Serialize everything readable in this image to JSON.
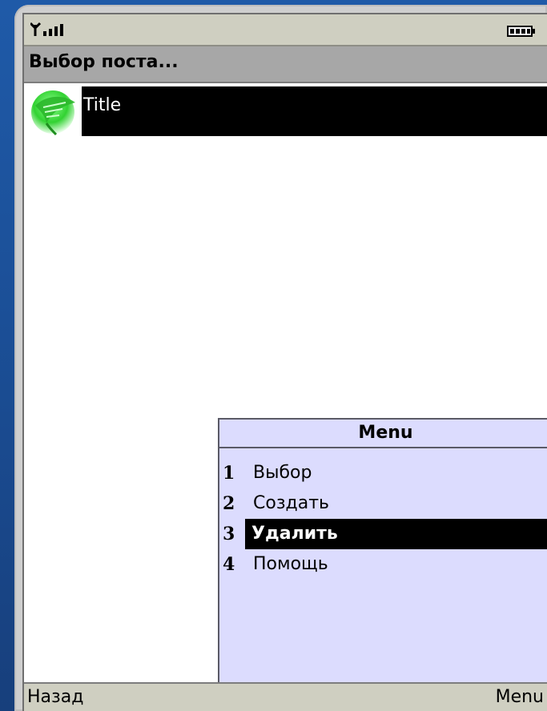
{
  "window": {
    "title": "Выбор поста..."
  },
  "status_bar": {
    "signal_icon": "signal-icon",
    "battery_icon": "battery-icon"
  },
  "list": {
    "items": [
      {
        "label": "Title",
        "icon": "feather-icon",
        "selected": true
      }
    ]
  },
  "menu": {
    "title": "Menu",
    "items": [
      {
        "number": "1",
        "label": "Выбор",
        "selected": false
      },
      {
        "number": "2",
        "label": "Создать",
        "selected": false
      },
      {
        "number": "3",
        "label": "Удалить",
        "selected": true
      },
      {
        "number": "4",
        "label": "Помощь",
        "selected": false
      }
    ]
  },
  "softkeys": {
    "left": "Назад",
    "right": "Menu"
  },
  "colors": {
    "background": "#1f5aa8",
    "menu_bg": "#dcdcfe",
    "selection": "#000000"
  }
}
